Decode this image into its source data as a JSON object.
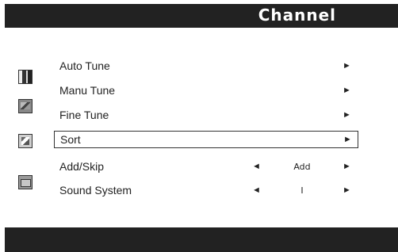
{
  "header": {
    "title": "Channel"
  },
  "sidebar": {
    "icons": [
      {
        "name": "tv-picture-icon"
      },
      {
        "name": "tuner-icon"
      },
      {
        "name": "hand-icon"
      },
      {
        "name": "settings-icon"
      }
    ]
  },
  "menu": {
    "items": [
      {
        "label": "Auto Tune",
        "arrow_right": "►"
      },
      {
        "label": "Manu Tune",
        "arrow_right": "►"
      },
      {
        "label": "Fine Tune",
        "arrow_right": "►"
      },
      {
        "label": "Sort",
        "arrow_right": "►",
        "selected": true
      },
      {
        "label": "Add/Skip",
        "arrow_left": "◄",
        "value": "Add",
        "arrow_right": "►"
      },
      {
        "label": "Sound System",
        "arrow_left": "◄",
        "value": "I",
        "arrow_right": "►"
      }
    ]
  },
  "colors": {
    "bar": "#222222",
    "text": "#222222",
    "background": "#ffffff"
  }
}
